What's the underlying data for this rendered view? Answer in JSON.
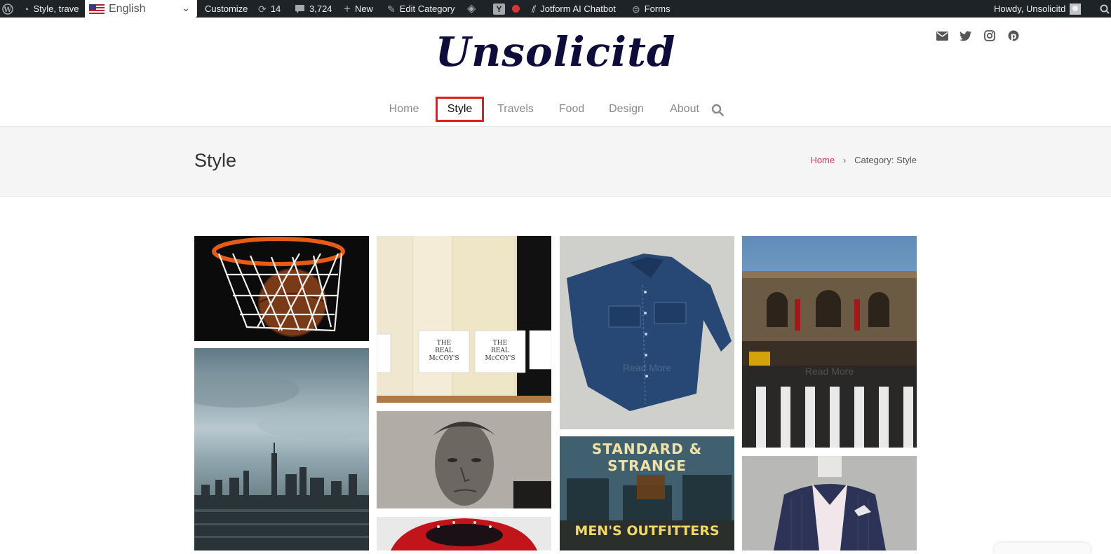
{
  "adminbar": {
    "site_label": "Style, trave",
    "language": "English",
    "customize": "Customize",
    "updates": "14",
    "comments": "3,724",
    "new": "New",
    "edit_category": "Edit Category",
    "chatbot": "Jotform AI Chatbot",
    "forms": "Forms",
    "howdy": "Howdy, Unsolicitd"
  },
  "header": {
    "logo": "Unsolicitd",
    "social_icons": [
      "email-icon",
      "twitter-icon",
      "instagram-icon",
      "pinterest-icon"
    ]
  },
  "nav": {
    "items": [
      {
        "label": "Home"
      },
      {
        "label": "Style"
      },
      {
        "label": "Travels"
      },
      {
        "label": "Food"
      },
      {
        "label": "Design"
      },
      {
        "label": "About"
      }
    ],
    "active": "Style",
    "highlight_color": "#e31b1b"
  },
  "page": {
    "title": "Style",
    "breadcrumb": {
      "home": "Home",
      "current": "Category: Style"
    },
    "accent_color": "#e3306c"
  },
  "grid": {
    "read_more": "Read More",
    "images": [
      "basketball-hoop-image",
      "skyline-image",
      "socks-image",
      "portrait-image",
      "red-car-image",
      "denim-shirt-image",
      "storefront-image",
      "museum-image",
      "suit-mannequin-image"
    ],
    "storefront_sign": "STANDARD & STRANGE",
    "storefront_sub": "MEN'S OUTFITTERS",
    "socks_label": "THE REAL McCOY'S"
  }
}
